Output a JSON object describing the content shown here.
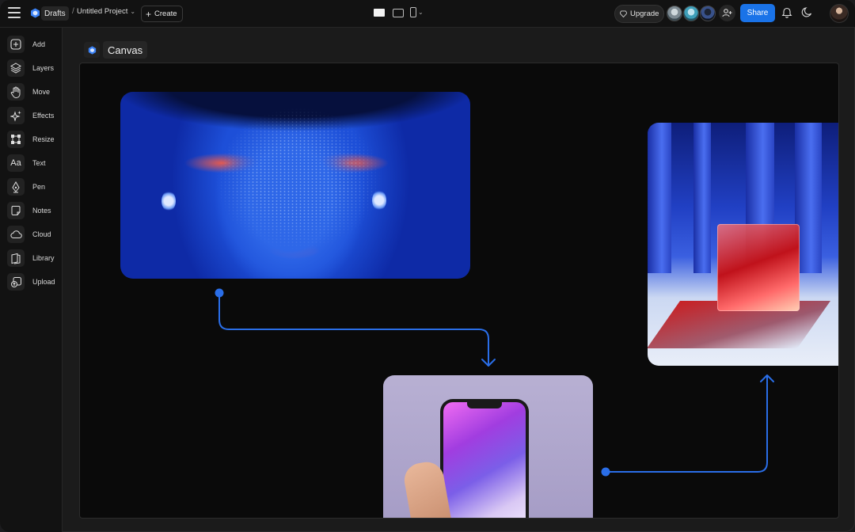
{
  "topbar": {
    "breadcrumb_root": "Drafts",
    "breadcrumb_separator": "/",
    "project_name": "Untitled Project",
    "create_label": "Create",
    "upgrade_label": "Upgrade",
    "share_label": "Share",
    "accent_color": "#1a73e8"
  },
  "tools": [
    {
      "label": "Add",
      "icon": "plus-square-icon"
    },
    {
      "label": "Layers",
      "icon": "layers-icon"
    },
    {
      "label": "Move",
      "icon": "hand-icon"
    },
    {
      "label": "Effects",
      "icon": "sparkles-icon"
    },
    {
      "label": "Resize",
      "icon": "resize-icon"
    },
    {
      "label": "Text",
      "icon": "text-icon"
    },
    {
      "label": "Pen",
      "icon": "pen-icon"
    },
    {
      "label": "Notes",
      "icon": "note-icon"
    },
    {
      "label": "Cloud",
      "icon": "cloud-icon"
    },
    {
      "label": "Library",
      "icon": "library-icon"
    },
    {
      "label": "Upload",
      "icon": "upload-icon"
    }
  ],
  "canvas": {
    "title": "Canvas",
    "connector_color": "#2a6ee8"
  }
}
